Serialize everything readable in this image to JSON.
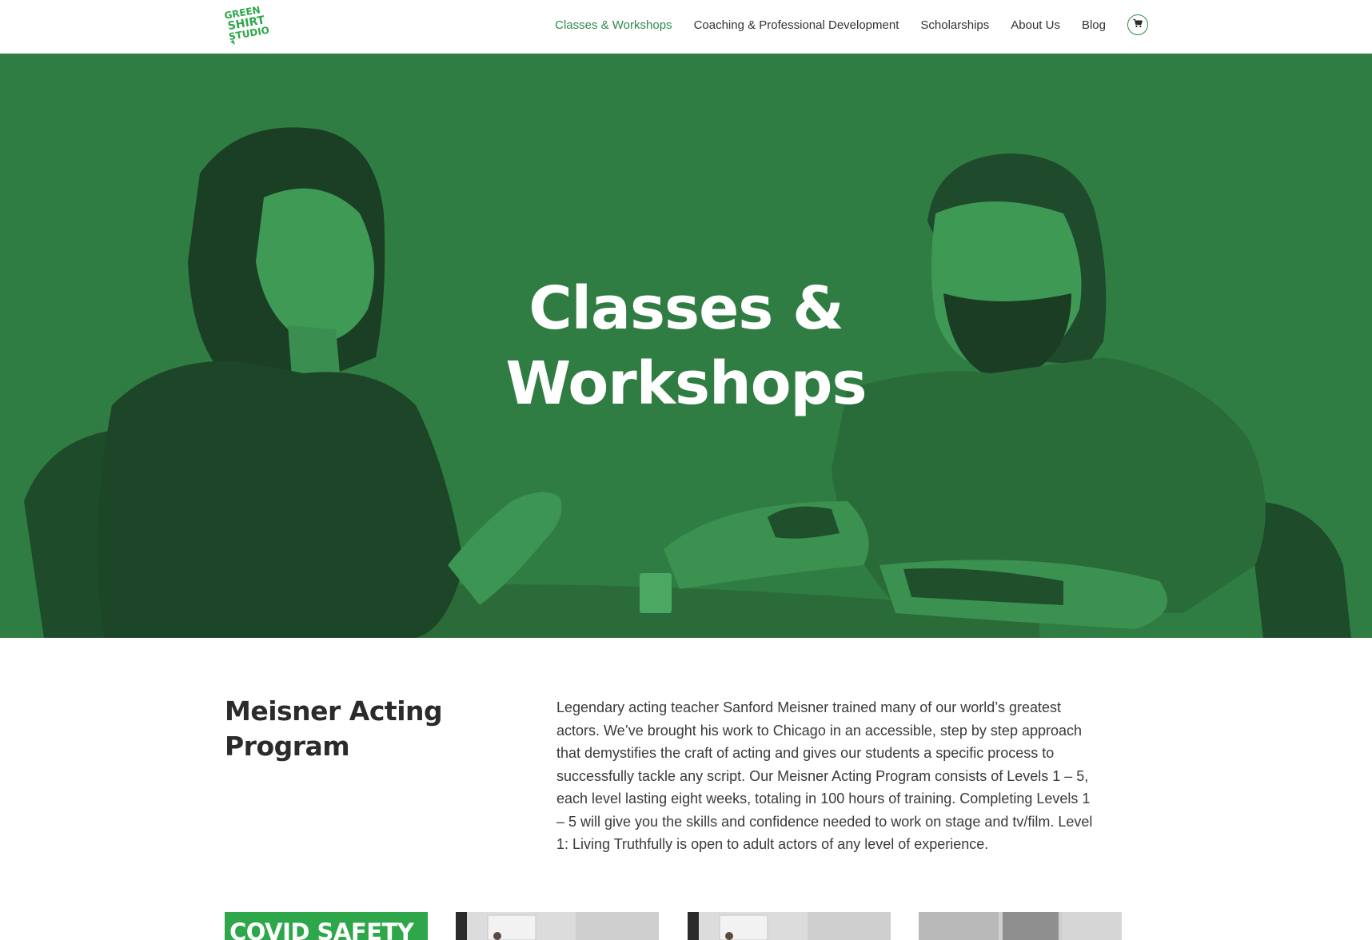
{
  "brand": {
    "logo_text": [
      "GREEN",
      "SHIRT",
      "STUDIO"
    ],
    "accent_color": "#2e8b4a",
    "hero_color": "#2f7d42",
    "badge_color": "#2ea74a"
  },
  "nav": {
    "items": [
      {
        "label": "Classes & Workshops",
        "active": true
      },
      {
        "label": "Coaching & Professional Development",
        "active": false
      },
      {
        "label": "Scholarships",
        "active": false
      },
      {
        "label": "About Us",
        "active": false
      },
      {
        "label": "Blog",
        "active": false
      }
    ],
    "cart_icon": "cart-icon"
  },
  "hero": {
    "title_line1": "Classes &",
    "title_line2": "Workshops"
  },
  "program": {
    "title_line1": "Meisner Acting",
    "title_line2": "Program",
    "description": "Legendary acting teacher Sanford Meisner trained many of our world’s greatest actors. We’ve brought his work to Chicago in an accessible, step by step approach that demystifies the craft of acting and gives our students a specific process to successfully tackle any script. Our Meisner Acting Program consists of Levels 1 – 5, each level lasting eight weeks, totaling in 100 hours of training. Completing Levels 1 – 5 will give you the skills and confidence needed to work on stage and tv/film. Level 1: Living Truthfully is open to adult actors of any level of experience."
  },
  "cards": {
    "covid_label": "COVID SAFETY"
  }
}
